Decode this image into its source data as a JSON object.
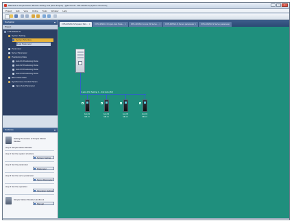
{
  "window": {
    "title": "MELSOFT Simple Motion Module Setting Tool (New Project) - [QD77GF4 / FX5-40SSC-S] System Structure]",
    "controls": [
      "-",
      "□",
      "×"
    ]
  },
  "menu": [
    "Project",
    "Edit",
    "View",
    "Online",
    "Tools",
    "Window",
    "Help"
  ],
  "navigation": {
    "header": "Navigation",
    "subheader": "Project",
    "tree": [
      "FX5-40SSC-S",
      "System Setting",
      "System Structure",
      "Read Parameter",
      "Parameter",
      "Servo Parameter",
      "Positioning Data",
      "Axis #1 Positioning Data",
      "Axis #2 Positioning Data",
      "Axis #3 Positioning Data",
      "Axis #4 Positioning Data",
      "Block Start Data",
      "Synchronous Control Param",
      "Input Axis Parameter"
    ]
  },
  "guidance": {
    "header": "Guidance",
    "intro_title": "Setting Procedure of Simple Motion Module",
    "step0": "step 0 Simple Motion Module",
    "step1": "step 1 Set the system structure",
    "step1_btn": "System Setting",
    "step2": "step 2 Set the parameter",
    "step2_btn": "Parameter",
    "step3": "step 3 Set the servo parameter",
    "step3_btn": "Servo Parameter",
    "step4": "step 4 Set the operation",
    "step4_btn": "Operation Setting",
    "manual_title": "Simple Motion Module Handbook",
    "manual_btn": "Manual"
  },
  "tabs": [
    {
      "label": "FX5-40SSC-S System Stru..."
    },
    {
      "label": "FX5-40SSC-S Input Axis Para..."
    },
    {
      "label": "FX5-40SSC-S Axis #1 Servo..."
    },
    {
      "label": "FX5-40SSC-S Servo parameter"
    },
    {
      "label": "FX5-40SSC-S Servo parameter"
    }
  ],
  "diagram": {
    "link_label": "1 axis (#1) Setting 1 - 2nd Axis (#2)",
    "amps": [
      {
        "label": "Axis #1",
        "sub": "MR-J4"
      },
      {
        "label": "Axis #2",
        "sub": "MR-J4"
      },
      {
        "label": "Axis #3",
        "sub": "MR-J4"
      },
      {
        "label": "Axis #4",
        "sub": "MR-J4"
      }
    ]
  },
  "colors": {
    "canvas": "#1f8f7d",
    "tree_bg": "#2c3f63",
    "selection": "#e8b43c",
    "link": "#2f62c6"
  }
}
